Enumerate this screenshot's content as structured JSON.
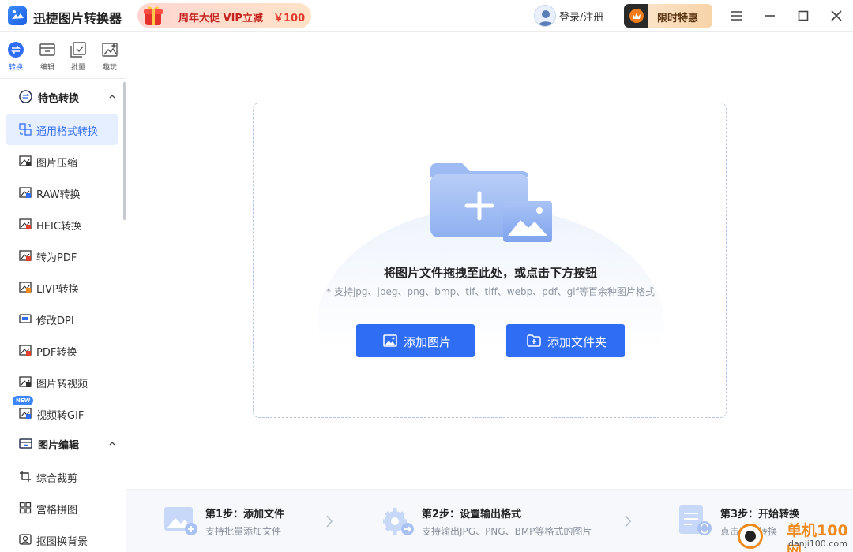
{
  "app": {
    "title": "迅捷图片转换器",
    "icon": "app-logo-icon"
  },
  "promo": {
    "text": "周年大促 VIP立减",
    "price": "￥100",
    "icon": "gift-icon"
  },
  "account": {
    "login_label": "登录/注册",
    "limited_offer_label": "限时特惠"
  },
  "window_controls": [
    "menu-icon",
    "minimize-icon",
    "maximize-icon",
    "close-icon"
  ],
  "top_tabs": [
    {
      "label": "转换",
      "icon": "convert-icon",
      "active": true
    },
    {
      "label": "编辑",
      "icon": "edit-icon",
      "active": false
    },
    {
      "label": "批量",
      "icon": "batch-icon",
      "active": false
    },
    {
      "label": "趣玩",
      "icon": "fun-icon",
      "active": false
    }
  ],
  "sidebar": {
    "sections": [
      {
        "title": "特色转换",
        "icon": "convert-circle-icon",
        "expanded": true,
        "items": [
          {
            "label": "通用格式转换",
            "icon": "format-convert-icon",
            "active": true
          },
          {
            "label": "图片压缩",
            "icon": "compress-icon"
          },
          {
            "label": "RAW转换",
            "icon": "raw-icon"
          },
          {
            "label": "HEIC转换",
            "icon": "heic-icon"
          },
          {
            "label": "转为PDF",
            "icon": "pdf-icon"
          },
          {
            "label": "LIVP转换",
            "icon": "livp-icon"
          },
          {
            "label": "修改DPI",
            "icon": "dpi-icon"
          },
          {
            "label": "PDF转换",
            "icon": "pdf-convert-icon"
          },
          {
            "label": "图片转视频",
            "icon": "video-icon"
          },
          {
            "label": "视频转GIF",
            "icon": "gif-icon",
            "badge": "NEW"
          }
        ]
      },
      {
        "title": "图片编辑",
        "icon": "image-edit-icon",
        "expanded": true,
        "items": [
          {
            "label": "综合裁剪",
            "icon": "crop-icon"
          },
          {
            "label": "宫格拼图",
            "icon": "grid-icon"
          },
          {
            "label": "抠图换背景",
            "icon": "cutout-icon"
          }
        ]
      }
    ]
  },
  "dropzone": {
    "title": "将图片文件拖拽至此处，或点击下方按钮",
    "hint": "* 支持jpg、jpeg、png、bmp、tif、tiff、webp、pdf、gif等百余种图片格式",
    "add_image_label": "添加图片",
    "add_folder_label": "添加文件夹"
  },
  "steps": [
    {
      "title": "第1步：添加文件",
      "desc": "支持批量添加文件",
      "icon": "add-file-step-icon"
    },
    {
      "title": "第2步：设置输出格式",
      "desc": "支持输出JPG、PNG、BMP等格式的图片",
      "icon": "settings-step-icon"
    },
    {
      "title": "第3步：开始转换",
      "desc": "点击开始转换",
      "icon": "start-convert-step-icon"
    }
  ],
  "watermark": {
    "text": "单机100网",
    "domain": "danji100.com"
  },
  "colors": {
    "accent": "#2f6df5",
    "active_bg": "#e6efff",
    "promo_text": "#c4231f",
    "watermark": "#f08a1d"
  }
}
